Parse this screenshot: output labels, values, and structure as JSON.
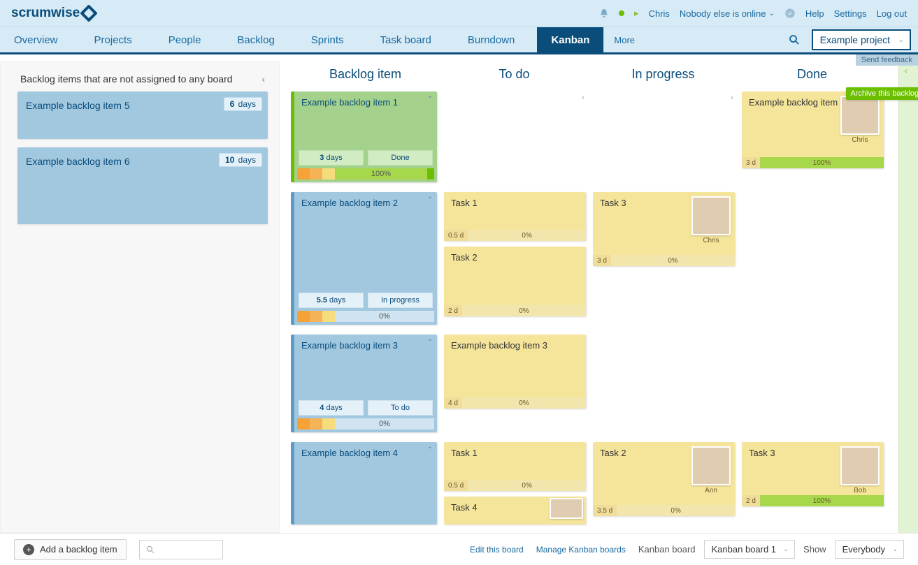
{
  "brand": "scrumwise",
  "top": {
    "user": "Chris",
    "online": "Nobody else is online",
    "help": "Help",
    "settings": "Settings",
    "logout": "Log out"
  },
  "nav": {
    "tabs": [
      "Overview",
      "Projects",
      "People",
      "Backlog",
      "Sprints",
      "Task board",
      "Burndown",
      "Kanban"
    ],
    "more": "More",
    "project": "Example project"
  },
  "feedback": "Send feedback",
  "sidebar": {
    "title": "Backlog items that are not assigned to any board",
    "items": [
      {
        "title": "Example backlog item 5",
        "value": "6",
        "unit": "days"
      },
      {
        "title": "Example backlog item 6",
        "value": "10",
        "unit": "days"
      }
    ]
  },
  "columns": [
    "Backlog item",
    "To do",
    "In progress",
    "Done"
  ],
  "archive_tip": "Archive this backlog item",
  "rows": [
    {
      "backlog": {
        "title": "Example backlog item 1",
        "color": "green",
        "estimate": "3",
        "unit": "days",
        "status": "Done",
        "progress": "100%"
      },
      "todo": [],
      "inprogress": [],
      "done": [
        {
          "title": "Example backlog item 1",
          "avatar": "Chris",
          "duration": "3 d",
          "progress": "100%",
          "h": 110
        }
      ]
    },
    {
      "backlog": {
        "title": "Example backlog item 2",
        "color": "blue",
        "estimate": "5.5",
        "unit": "days",
        "status": "In progress",
        "progress": "0%",
        "h": 190
      },
      "todo": [
        {
          "title": "Task 1",
          "duration": "0.5 d",
          "progress": "0%",
          "h": 70
        },
        {
          "title": "Task 2",
          "duration": "2 d",
          "progress": "0%",
          "h": 100
        }
      ],
      "inprogress": [
        {
          "title": "Task 3",
          "avatar": "Chris",
          "duration": "3 d",
          "progress": "0%",
          "h": 106
        }
      ],
      "done": []
    },
    {
      "backlog": {
        "title": "Example backlog item 3",
        "color": "blue",
        "estimate": "4",
        "unit": "days",
        "status": "To do",
        "progress": "0%",
        "h": 140
      },
      "todo": [
        {
          "title": "Example backlog item 3",
          "duration": "4 d",
          "progress": "0%",
          "h": 106
        }
      ],
      "inprogress": [],
      "done": []
    },
    {
      "backlog": {
        "title": "Example backlog item 4",
        "color": "blue",
        "h": 118
      },
      "todo": [
        {
          "title": "Task 1",
          "duration": "0.5 d",
          "progress": "0%",
          "h": 70
        },
        {
          "title": "Task 4",
          "avatar": "",
          "h": 40
        }
      ],
      "inprogress": [
        {
          "title": "Task 2",
          "avatar": "Ann",
          "duration": "3.5 d",
          "progress": "0%",
          "h": 106
        }
      ],
      "done": [
        {
          "title": "Task 3",
          "avatar": "Bob",
          "duration": "2 d",
          "progress": "100%",
          "h": 92
        }
      ]
    }
  ],
  "bottom": {
    "add": "Add a backlog item",
    "edit": "Edit this board",
    "manage": "Manage Kanban boards",
    "board_label": "Kanban board",
    "board_value": "Kanban board 1",
    "show_label": "Show",
    "show_value": "Everybody"
  }
}
